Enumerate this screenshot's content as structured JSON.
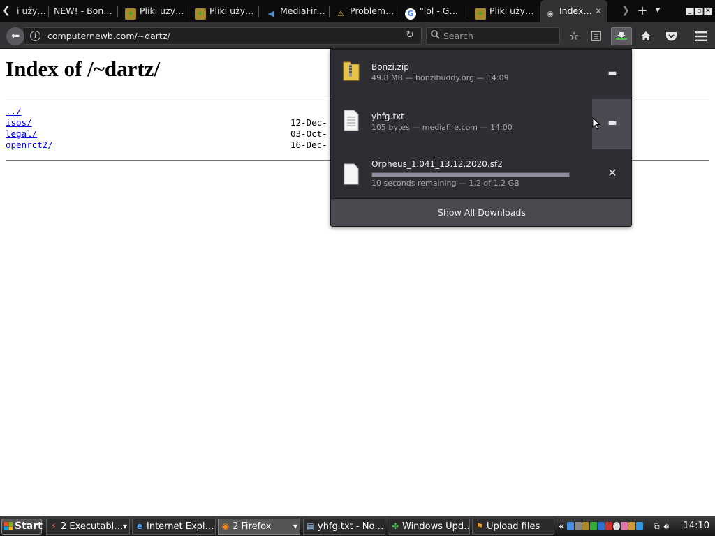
{
  "window": {
    "tabs": [
      {
        "label": "i uży…",
        "icon": "none"
      },
      {
        "label": "NEW! - Bon…",
        "icon": "none"
      },
      {
        "label": "Pliki uży…",
        "icon": "bonzi-icon"
      },
      {
        "label": "Pliki uży…",
        "icon": "bonzi-icon"
      },
      {
        "label": "MediaFir…",
        "icon": "mediafire-icon"
      },
      {
        "label": "Problem…",
        "icon": "warning-icon"
      },
      {
        "label": "\"lol - G…",
        "icon": "google-icon"
      },
      {
        "label": "Pliki uży…",
        "icon": "bonzi-icon"
      },
      {
        "label": "Index…",
        "icon": "page-icon",
        "active": true
      }
    ]
  },
  "navbar": {
    "url": "computernewb.com/~dartz/",
    "search_placeholder": "Search"
  },
  "page": {
    "title": "Index of /~dartz/",
    "entries": [
      {
        "name": "../",
        "date": ""
      },
      {
        "name": "isos/",
        "date": "12-Dec-"
      },
      {
        "name": "legal/",
        "date": "03-Oct-"
      },
      {
        "name": "openrct2/",
        "date": "16-Dec-"
      }
    ]
  },
  "downloads": {
    "items": [
      {
        "name": "Bonzi.zip",
        "meta": "49.8 MB — bonzibuddy.org — 14:09",
        "type": "zip",
        "action": "folder-icon"
      },
      {
        "name": "yhfg.txt",
        "meta": "105 bytes — mediafire.com — 14:00",
        "type": "text",
        "action": "folder-icon"
      },
      {
        "name": "Orpheus_1.041_13.12.2020.sf2",
        "meta": "10 seconds remaining — 1.2 of 1.2 GB",
        "type": "file",
        "action": "cancel-icon",
        "progress": 1.0
      }
    ],
    "show_all": "Show All Downloads"
  },
  "taskbar": {
    "start_label": "Start",
    "tasks": [
      {
        "label": "2 Executabl…",
        "icon": "executable-icon",
        "group": true
      },
      {
        "label": "Internet Expl…",
        "icon": "ie-icon"
      },
      {
        "label": "2 Firefox",
        "icon": "firefox-icon",
        "group": true,
        "active": true
      },
      {
        "label": "yhfg.txt - No…",
        "icon": "notepad-icon"
      },
      {
        "label": "Windows Upd…",
        "icon": "windows-update-icon"
      },
      {
        "label": "Upload files",
        "icon": "upload-icon"
      }
    ],
    "clock": "14:10"
  }
}
